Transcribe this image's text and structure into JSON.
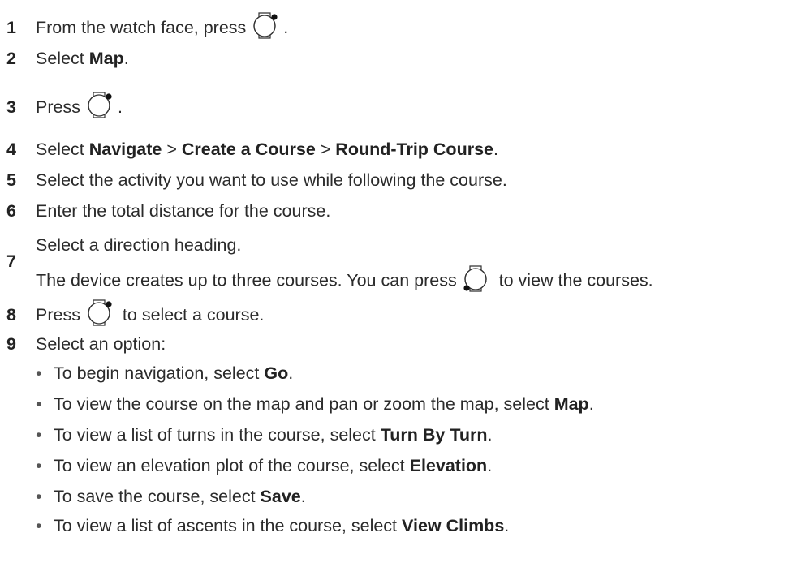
{
  "steps": [
    {
      "num": "1",
      "parts": [
        "From the watch face, press ",
        "[start-icon]",
        "."
      ]
    },
    {
      "num": "2",
      "parts": [
        "Select ",
        "**Map",
        "."
      ]
    },
    {
      "num": "3",
      "parts": [
        "Press ",
        "[start-icon]",
        "."
      ]
    },
    {
      "num": "4",
      "parts": [
        "Select ",
        "**Navigate",
        " > ",
        "**Create a Course",
        " > ",
        "**Round-Trip Course",
        "."
      ]
    },
    {
      "num": "5",
      "parts": [
        "Select the activity you want to use while following the course."
      ]
    },
    {
      "num": "6",
      "parts": [
        "Enter the total distance for the course."
      ]
    },
    {
      "num": "7",
      "parts": [
        "Select a direction heading."
      ]
    },
    {
      "num": "8",
      "parts": [
        "Press ",
        "[start-icon]",
        " to select a course."
      ]
    },
    {
      "num": "9",
      "parts": [
        "Select an option:"
      ]
    }
  ],
  "step7_note": [
    "The device creates up to three courses. You can press ",
    "[down-icon]",
    " to view the courses."
  ],
  "options": [
    [
      "To begin navigation, select ",
      "**Go",
      "."
    ],
    [
      "To view the course on the map and pan or zoom the map, select ",
      "**Map",
      "."
    ],
    [
      "To view a list of turns in the course, select ",
      "**Turn By Turn",
      "."
    ],
    [
      "To view an elevation plot of the course, select ",
      "**Elevation",
      "."
    ],
    [
      "To save the course, select ",
      "**Save",
      "."
    ],
    [
      "To view a list of ascents in the course, select ",
      "**View Climbs",
      "."
    ]
  ],
  "bullet_char": "•",
  "icons": {
    "start": "start-stop-button-icon",
    "down": "down-button-icon"
  }
}
